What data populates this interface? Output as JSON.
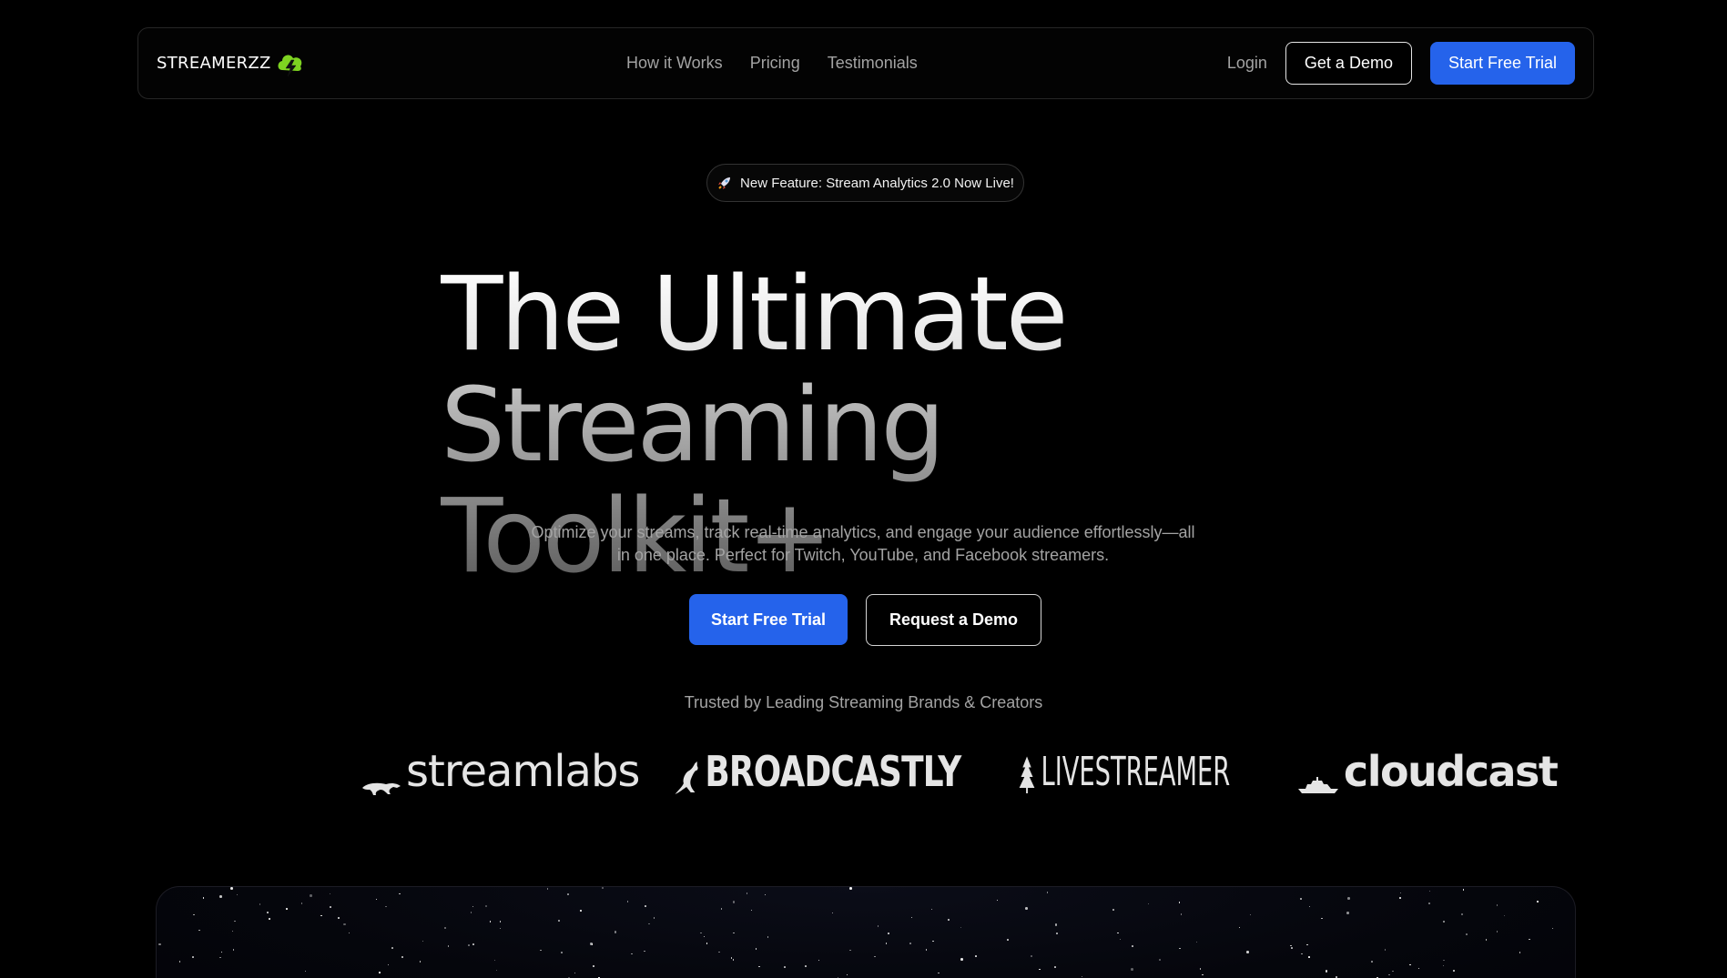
{
  "brand": {
    "name": "STREAMERZZ",
    "logo_icon": "cloud-lightning-icon",
    "accent": "#7ed321"
  },
  "nav": {
    "links": [
      "How it Works",
      "Pricing",
      "Testimonials"
    ],
    "login": "Login",
    "get_demo": "Get a Demo",
    "start_trial": "Start Free Trial"
  },
  "badge": {
    "icon": "rocket-icon",
    "text": "New Feature: Stream Analytics 2.0 Now Live!"
  },
  "hero": {
    "line1": "The Ultimate",
    "line2": "Streaming Toolkit+",
    "subtitle": "Optimize your streams, track real-time analytics, and engage your audience effortlessly—all in one place. Perfect for Twitch, YouTube, and Facebook streamers.",
    "cta_primary": "Start Free Trial",
    "cta_secondary": "Request a Demo"
  },
  "trusted": {
    "label": "Trusted by Leading Streaming Brands & Creators",
    "logos": [
      {
        "name": "streamlabs",
        "icon": "panther-icon"
      },
      {
        "name": "BROADCASTLY",
        "icon": "kangaroo-icon"
      },
      {
        "name": "LIVESTREAMER",
        "icon": "tree-icon"
      },
      {
        "name": "cloudcast",
        "icon": "ship-icon"
      }
    ]
  },
  "colors": {
    "primary": "#2563eb",
    "background": "#000000",
    "muted_text": "#a3a3a3"
  }
}
